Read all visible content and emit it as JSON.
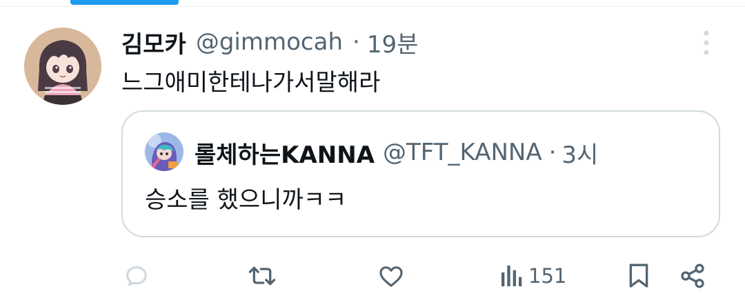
{
  "colors": {
    "accent": "#1d9bf0",
    "text_primary": "#0f1419",
    "text_secondary": "#536471",
    "border": "#cfd9de",
    "icon_muted": "#cfd9de"
  },
  "tweet": {
    "author_name": "김모카",
    "handle": "@gimmocah",
    "separator": "·",
    "time": "19분",
    "text": "느그애미한테나가서말해라",
    "avatar_icon": "anime-girl-avatar"
  },
  "quote": {
    "author_name": "롤체하는KANNA",
    "handle": "@TFT_KANNA",
    "separator": "·",
    "time": "3시",
    "text": "승소를 했으니까ㅋㅋ",
    "avatar_icon": "anime-character-avatar"
  },
  "actions": {
    "reply_icon": "reply-icon",
    "retweet_icon": "retweet-icon",
    "like_icon": "heart-icon",
    "views_icon": "analytics-icon",
    "view_count": "151",
    "bookmark_icon": "bookmark-icon",
    "share_icon": "share-icon"
  }
}
